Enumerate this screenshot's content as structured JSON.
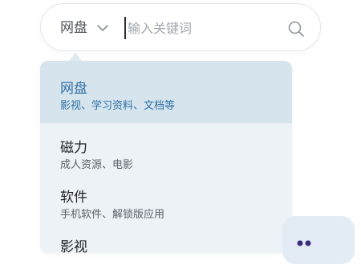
{
  "search": {
    "scope_label": "网盘",
    "placeholder": "输入关键词",
    "value": ""
  },
  "dropdown": {
    "items": [
      {
        "title": "网盘",
        "subtitle": "影视、学习资料、文档等",
        "active": true
      },
      {
        "title": "磁力",
        "subtitle": "成人资源、电影",
        "active": false
      },
      {
        "title": "软件",
        "subtitle": "手机软件、解锁版应用",
        "active": false
      },
      {
        "title": "影视",
        "subtitle": "",
        "active": false
      }
    ]
  },
  "icons": {
    "scope_toggle": "chevron-down-icon",
    "search": "search-icon",
    "bubble": "more-dots-icon"
  },
  "colors": {
    "active_text": "#2e6fa3",
    "active_bg": "#d6e4ee",
    "dropdown_bg": "#edf2f6",
    "bubble_bg": "#e3ecf5",
    "dots": "#3a2a7a"
  }
}
